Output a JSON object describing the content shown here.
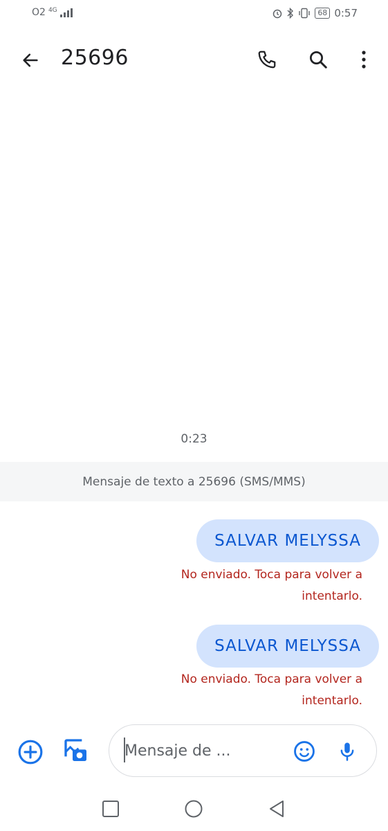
{
  "status_bar": {
    "carrier": "O2",
    "network": "4G",
    "time": "0:57",
    "battery": "68"
  },
  "header": {
    "title": "25696",
    "icons": [
      "back-arrow-icon",
      "phone-icon",
      "search-icon",
      "more-vert-icon"
    ]
  },
  "conversation": {
    "timestamp": "0:23",
    "banner": "Mensaje de texto a 25696 (SMS/MMS)",
    "messages": [
      {
        "text": "SALVAR MELYSSA",
        "error_line1": "No enviado. Toca para volver a",
        "error_line2": "intentarlo."
      },
      {
        "text": "SALVAR MELYSSA",
        "error_line1": "No enviado. Toca para volver a",
        "error_line2": "intentarlo."
      }
    ]
  },
  "compose": {
    "placeholder": "Mensaje de ...",
    "value": ""
  },
  "colors": {
    "accent": "#1a73e8",
    "bubble": "#d3e3fd",
    "bubble_text": "#0b57d0",
    "error": "#b3261e"
  }
}
